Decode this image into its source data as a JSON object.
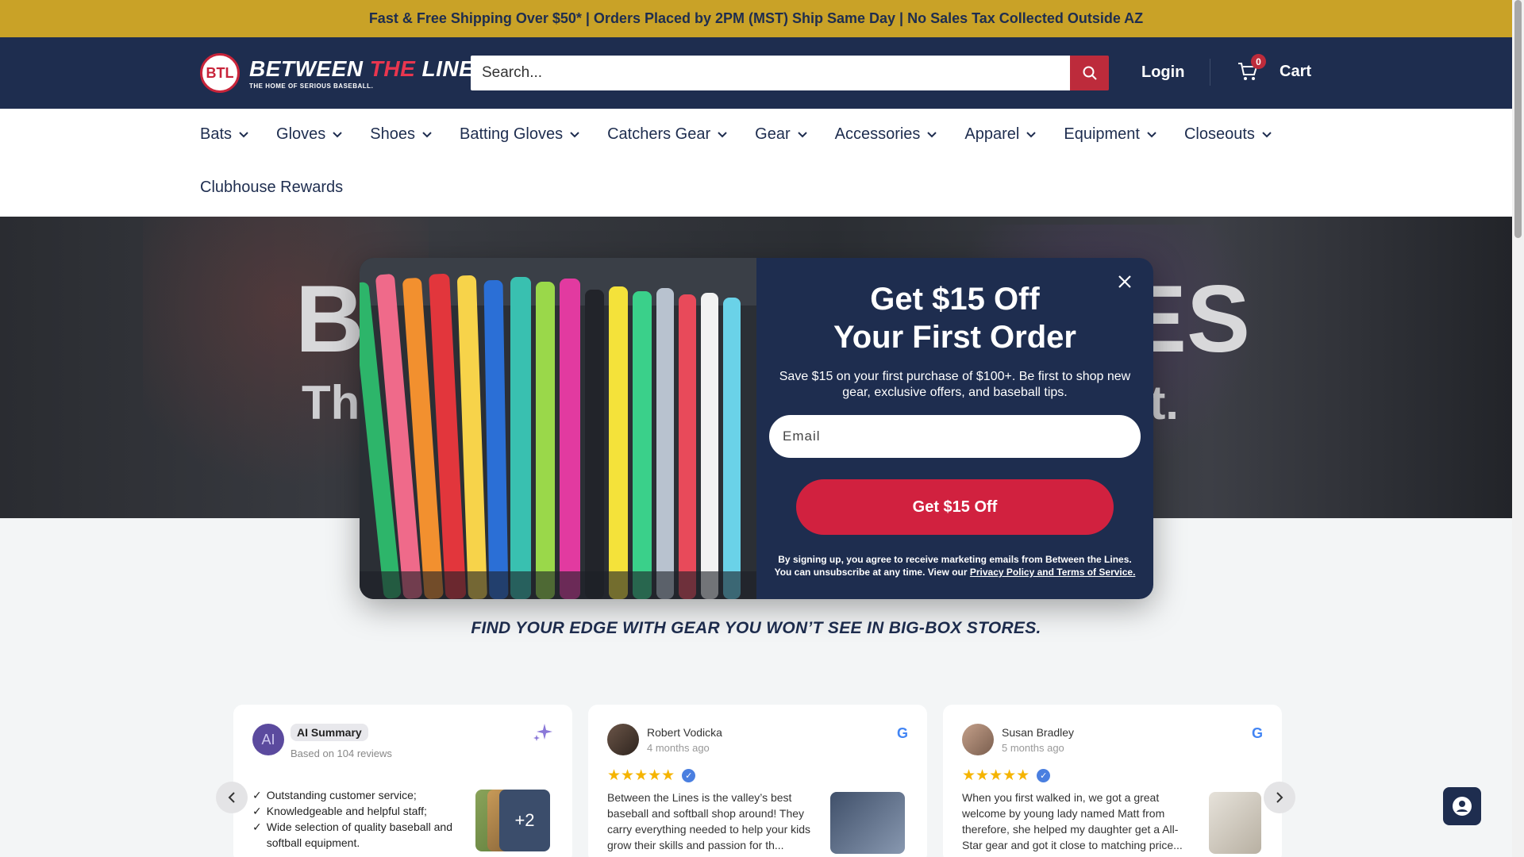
{
  "announcement": "Fast & Free Shipping Over $50* | Orders Placed by 2PM (MST) Ship Same Day | No Sales Tax Collected Outside AZ",
  "header": {
    "logo_badge": "BTL",
    "logo_title_1": "BETWEEN ",
    "logo_title_2": "THE",
    "logo_title_3": " LINES",
    "logo_tagline": "THE HOME OF SERIOUS BASEBALL.",
    "search_placeholder": "Search...",
    "login": "Login",
    "cart_count": "0",
    "cart_label": "Cart"
  },
  "nav": {
    "items": [
      "Bats",
      "Gloves",
      "Shoes",
      "Batting Gloves",
      "Catchers Gear",
      "Gear",
      "Accessories",
      "Apparel",
      "Equipment",
      "Closeouts"
    ],
    "second_row": "Clubhouse Rewards"
  },
  "hero": {
    "left_big": "B",
    "left_small": "Th",
    "right_big": "ES",
    "right_small": "t It."
  },
  "tagline": "FIND YOUR EDGE WITH GEAR YOU WON’T SEE IN BIG-BOX STORES.",
  "reviews": {
    "ai": {
      "avatar": "AI",
      "label": "AI Summary",
      "sub": "Based on 104 reviews",
      "bullets": [
        "Outstanding customer service;",
        "Knowledgeable and helpful staff;",
        "Wide selection of quality baseball and softball equipment."
      ],
      "more": "+2"
    },
    "cards": [
      {
        "name": "Robert Vodicka",
        "time": "4 months ago",
        "text": "Between the Lines is the valley’s best baseball and softball shop around! They carry everything needed to help your kids grow their skills and passion for th..."
      },
      {
        "name": "Susan Bradley",
        "time": "5 months ago",
        "text": "When you first walked in, we got a great welcome by young lady named Matt from therefore, she helped my daughter get a All-Star gear and got it close to matching price..."
      }
    ]
  },
  "popup": {
    "headline_1": "Get $15 Off",
    "headline_2": "Your First Order",
    "sub": "Save $15 on your first purchase of $100+. Be first to shop new gear, exclusive offers, and baseball tips.",
    "email_placeholder": "Email",
    "button": "Get $15 Off",
    "legal_1": "By signing up, you agree to receive marketing emails from Between the Lines.",
    "legal_2": "You can unsubscribe at any time. View our ",
    "legal_link": "Privacy Policy and Terms of Service."
  },
  "colors": {
    "announcement_bg": "#c9a227",
    "navy": "#1e2d4f",
    "brand_red": "#bd2b3b",
    "cta_red": "#d1213f"
  }
}
